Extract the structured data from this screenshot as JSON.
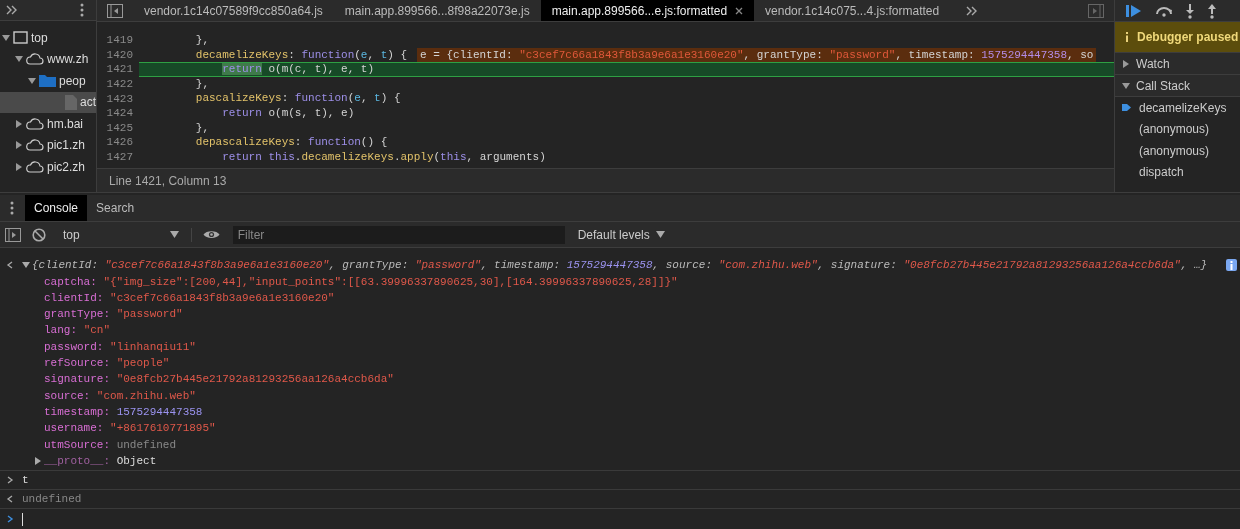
{
  "navigator": {
    "tree": [
      {
        "label": "top",
        "kind": "frame",
        "expanded": true,
        "selected": false,
        "children": [
          {
            "label": "www.zh",
            "kind": "domain",
            "expanded": true,
            "selected": false,
            "children": [
              {
                "label": "peop",
                "kind": "folder",
                "expanded": true,
                "selected": false,
                "children": [
                  {
                    "label": "act",
                    "kind": "file",
                    "selected": true
                  }
                ]
              }
            ]
          },
          {
            "label": "hm.bai",
            "kind": "domain",
            "expanded": false,
            "selected": false
          },
          {
            "label": "pic1.zh",
            "kind": "domain",
            "expanded": false,
            "selected": false
          },
          {
            "label": "pic2.zh",
            "kind": "domain",
            "expanded": false,
            "selected": false
          }
        ]
      }
    ]
  },
  "editor": {
    "tabs": [
      {
        "label": "vendor.1c14c07589f9cc850a64.js",
        "selected": false,
        "closable": false
      },
      {
        "label": "main.app.899566...8f98a22073e.js",
        "selected": false,
        "closable": false
      },
      {
        "label": "main.app.899566...e.js:formatted",
        "selected": true,
        "closable": true
      },
      {
        "label": "vendor.1c14c075...4.js:formatted",
        "selected": false,
        "closable": false
      }
    ],
    "lines": [
      {
        "number": "1419",
        "current": false,
        "tokens": [
          {
            "text": "        },",
            "kind": "punct"
          }
        ]
      },
      {
        "number": "1420",
        "current": false,
        "tokens": [
          {
            "text": "        decamelizeKeys",
            "kind": "prop"
          },
          {
            "text": ": ",
            "kind": "punct"
          },
          {
            "text": "function",
            "kind": "keyword"
          },
          {
            "text": "(",
            "kind": "punct"
          },
          {
            "text": "e",
            "kind": "param"
          },
          {
            "text": ", ",
            "kind": "punct"
          },
          {
            "text": "t",
            "kind": "param"
          },
          {
            "text": ") {",
            "kind": "punct"
          }
        ],
        "inline_value": [
          {
            "text": "e = {clientId: ",
            "kind": "plain"
          },
          {
            "text": "\"c3cef7c66a1843f8b3a9e6a1e3160e20\"",
            "kind": "string"
          },
          {
            "text": ", grantType: ",
            "kind": "plain"
          },
          {
            "text": "\"password\"",
            "kind": "string"
          },
          {
            "text": ", timestamp: ",
            "kind": "plain"
          },
          {
            "text": "1575294447358",
            "kind": "number"
          },
          {
            "text": ", so",
            "kind": "plain"
          }
        ]
      },
      {
        "number": "1421",
        "current": true,
        "tokens": [
          {
            "text": "            return",
            "kind": "exec"
          },
          {
            "text": " o(m(c, t), e, t)",
            "kind": "plain"
          }
        ]
      },
      {
        "number": "1422",
        "current": false,
        "tokens": [
          {
            "text": "        },",
            "kind": "punct"
          }
        ]
      },
      {
        "number": "1423",
        "current": false,
        "tokens": [
          {
            "text": "        pascalizeKeys",
            "kind": "prop"
          },
          {
            "text": ": ",
            "kind": "punct"
          },
          {
            "text": "function",
            "kind": "keyword"
          },
          {
            "text": "(",
            "kind": "punct"
          },
          {
            "text": "e",
            "kind": "param"
          },
          {
            "text": ", ",
            "kind": "punct"
          },
          {
            "text": "t",
            "kind": "param"
          },
          {
            "text": ") {",
            "kind": "punct"
          }
        ]
      },
      {
        "number": "1424",
        "current": false,
        "tokens": [
          {
            "text": "            return",
            "kind": "keyword"
          },
          {
            "text": " o(m(s, t), e)",
            "kind": "plain"
          }
        ]
      },
      {
        "number": "1425",
        "current": false,
        "tokens": [
          {
            "text": "        },",
            "kind": "punct"
          }
        ]
      },
      {
        "number": "1426",
        "current": false,
        "tokens": [
          {
            "text": "        depascalizeKeys",
            "kind": "prop"
          },
          {
            "text": ": ",
            "kind": "punct"
          },
          {
            "text": "function",
            "kind": "keyword"
          },
          {
            "text": "() {",
            "kind": "punct"
          }
        ]
      },
      {
        "number": "1427",
        "current": false,
        "tokens": [
          {
            "text": "            return this",
            "kind": "keyword"
          },
          {
            "text": ".",
            "kind": "punct"
          },
          {
            "text": "decamelizeKeys",
            "kind": "prop"
          },
          {
            "text": ".",
            "kind": "punct"
          },
          {
            "text": "apply",
            "kind": "prop"
          },
          {
            "text": "(",
            "kind": "punct"
          },
          {
            "text": "this",
            "kind": "keyword"
          },
          {
            "text": ", arguments)",
            "kind": "plain"
          }
        ]
      }
    ],
    "status": "Line 1421, Column 13"
  },
  "debugger": {
    "banner": "Debugger paused",
    "sections": [
      {
        "label": "Watch",
        "expanded": false
      },
      {
        "label": "Call Stack",
        "expanded": true
      }
    ],
    "frames": [
      {
        "label": "decamelizeKeys",
        "selected": true
      },
      {
        "label": "(anonymous)",
        "selected": false
      },
      {
        "label": "(anonymous)",
        "selected": false
      },
      {
        "label": "dispatch",
        "selected": false
      }
    ]
  },
  "console": {
    "tabs": [
      {
        "label": "Console",
        "selected": true
      },
      {
        "label": "Search",
        "selected": false
      }
    ],
    "context": "top",
    "filter": {
      "placeholder": "Filter"
    },
    "levels": "Default levels",
    "messages": [
      {
        "kind": "object",
        "expanded": true,
        "summary": [
          {
            "text": "{",
            "kind": "punct"
          },
          {
            "text": "clientId",
            "kind": "key"
          },
          {
            "text": ": ",
            "kind": "punct"
          },
          {
            "text": "\"c3cef7c66a1843f8b3a9e6a1e3160e20\"",
            "kind": "string"
          },
          {
            "text": ", ",
            "kind": "punct"
          },
          {
            "text": "grantType",
            "kind": "key"
          },
          {
            "text": ": ",
            "kind": "punct"
          },
          {
            "text": "\"password\"",
            "kind": "string"
          },
          {
            "text": ", ",
            "kind": "punct"
          },
          {
            "text": "timestamp",
            "kind": "key"
          },
          {
            "text": ": ",
            "kind": "punct"
          },
          {
            "text": "1575294447358",
            "kind": "number"
          },
          {
            "text": ", ",
            "kind": "punct"
          },
          {
            "text": "source",
            "kind": "key"
          },
          {
            "text": ": ",
            "kind": "punct"
          },
          {
            "text": "\"com.zhihu.web\"",
            "kind": "string"
          },
          {
            "text": ", ",
            "kind": "punct"
          },
          {
            "text": "signature",
            "kind": "key"
          },
          {
            "text": ": ",
            "kind": "punct"
          },
          {
            "text": "\"0e8fcb27b445e21792a81293256aa126a4ccb6da\"",
            "kind": "string"
          },
          {
            "text": ", …}",
            "kind": "punct"
          }
        ],
        "properties": [
          {
            "key": "captcha:",
            "value": "\"{\"img_size\":[200,44],\"input_points\":[[63.39996337890625,30],[164.39996337890625,28]]}\"",
            "kind": "string"
          },
          {
            "key": "clientId:",
            "value": "\"c3cef7c66a1843f8b3a9e6a1e3160e20\"",
            "kind": "string"
          },
          {
            "key": "grantType:",
            "value": "\"password\"",
            "kind": "string"
          },
          {
            "key": "lang:",
            "value": "\"cn\"",
            "kind": "string"
          },
          {
            "key": "password:",
            "value": "\"linhanqiu11\"",
            "kind": "string"
          },
          {
            "key": "refSource:",
            "value": "\"people\"",
            "kind": "string"
          },
          {
            "key": "signature:",
            "value": "\"0e8fcb27b445e21792a81293256aa126a4ccb6da\"",
            "kind": "string"
          },
          {
            "key": "source:",
            "value": "\"com.zhihu.web\"",
            "kind": "string"
          },
          {
            "key": "timestamp:",
            "value": "1575294447358",
            "kind": "number"
          },
          {
            "key": "username:",
            "value": "\"+8617610771895\"",
            "kind": "string"
          },
          {
            "key": "utmSource:",
            "value": "undefined",
            "kind": "undefined"
          },
          {
            "key": "__proto__:",
            "value": "Object",
            "kind": "object",
            "expanded": false
          }
        ]
      },
      {
        "kind": "input",
        "text": "t"
      },
      {
        "kind": "result",
        "text": "undefined"
      }
    ]
  }
}
